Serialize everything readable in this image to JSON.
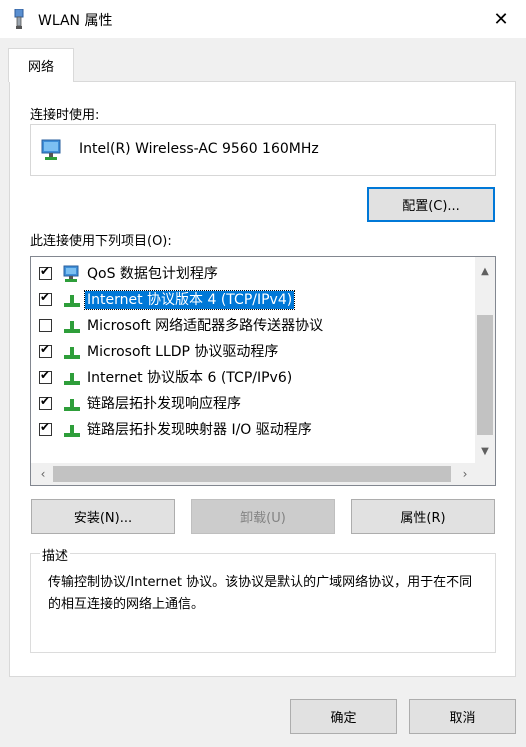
{
  "window": {
    "title": "WLAN 属性",
    "close_glyph": "✕",
    "icon": "network-adapter-icon"
  },
  "tabs": [
    {
      "label": "网络",
      "active": true
    }
  ],
  "connect_using": {
    "label": "连接时使用:",
    "adapter_name": "Intel(R) Wireless-AC 9560 160MHz",
    "configure_button": "配置(C)..."
  },
  "items_section": {
    "label": "此连接使用下列项目(O):",
    "items": [
      {
        "label": "QoS 数据包计划程序",
        "checked": true,
        "selected": false,
        "icon": "qos-scheduler-icon"
      },
      {
        "label": "Internet 协议版本 4 (TCP/IPv4)",
        "checked": true,
        "selected": true,
        "icon": "protocol-icon"
      },
      {
        "label": "Microsoft 网络适配器多路传送器协议",
        "checked": false,
        "selected": false,
        "icon": "protocol-icon"
      },
      {
        "label": "Microsoft LLDP 协议驱动程序",
        "checked": true,
        "selected": false,
        "icon": "protocol-icon"
      },
      {
        "label": "Internet 协议版本 6 (TCP/IPv6)",
        "checked": true,
        "selected": false,
        "icon": "protocol-icon"
      },
      {
        "label": "链路层拓扑发现响应程序",
        "checked": true,
        "selected": false,
        "icon": "protocol-icon"
      },
      {
        "label": "链路层拓扑发现映射器 I/O 驱动程序",
        "checked": true,
        "selected": false,
        "icon": "protocol-icon"
      }
    ]
  },
  "actions": {
    "install": "安装(N)...",
    "uninstall": "卸载(U)",
    "properties": "属性(R)"
  },
  "description": {
    "legend": "描述",
    "text": "传输控制协议/Internet 协议。该协议是默认的广域网络协议，用于在不同的相互连接的网络上通信。"
  },
  "footer": {
    "ok": "确定",
    "cancel": "取消"
  },
  "colors": {
    "selection": "#0078d7",
    "default_button_border": "#0078d7",
    "protocol_icon_green": "#2e9e3a"
  }
}
